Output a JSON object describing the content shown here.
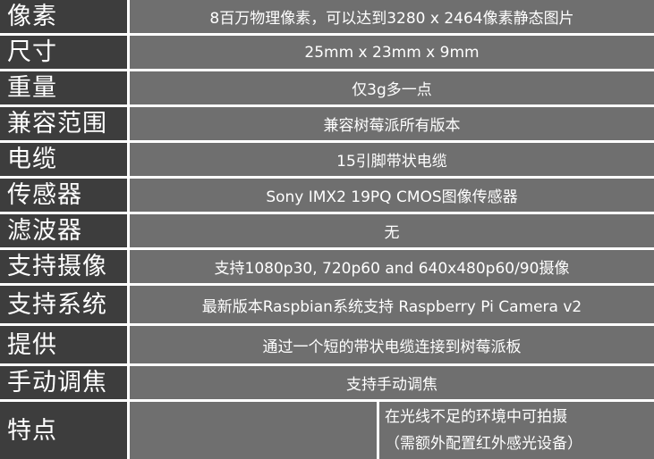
{
  "rows": [
    {
      "label": "像素",
      "value": "8百万物理像素，可以达到3280 x 2464像素静态图片"
    },
    {
      "label": "尺寸",
      "value": "25mm x 23mm x 9mm"
    },
    {
      "label": "重量",
      "value": "仅3g多一点"
    },
    {
      "label": "兼容范围",
      "value": "兼容树莓派所有版本"
    },
    {
      "label": "电缆",
      "value": "15引脚带状电缆"
    },
    {
      "label": "传感器",
      "value": "Sony IMX2 19PQ CMOS图像传感器"
    },
    {
      "label": "滤波器",
      "value": "无"
    },
    {
      "label": "支持摄像",
      "value": "支持1080p30, 720p60 and 640x480p60/90摄像"
    },
    {
      "label": "支持系统",
      "value": "最新版本Raspbian系统支持 Raspberry Pi Camera v2"
    },
    {
      "label": "提供",
      "value": "通过一个短的带状电缆连接到树莓派板"
    },
    {
      "label": "手动调焦",
      "value": "支持手动调焦"
    },
    {
      "label": "特点",
      "value": "",
      "note_line1": "在光线不足的环境中可拍摄",
      "note_line2": "（需额外配置红外感光设备）"
    }
  ]
}
